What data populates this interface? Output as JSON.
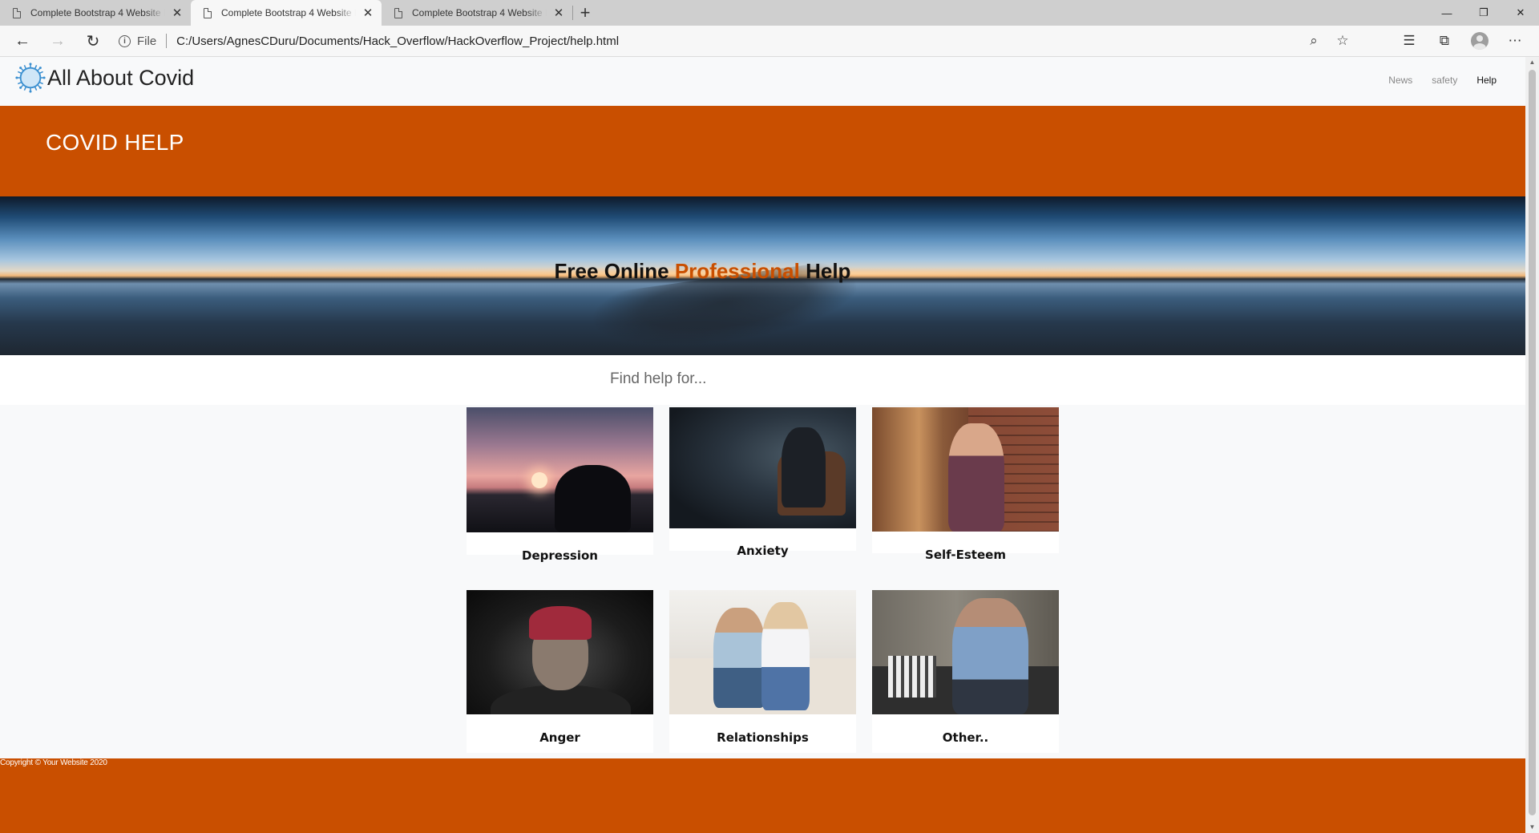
{
  "browser": {
    "tabs": [
      {
        "title": "Complete Bootstrap 4 Website Layout",
        "active": false
      },
      {
        "title": "Complete Bootstrap 4 Website Layout",
        "active": true
      },
      {
        "title": "Complete Bootstrap 4 Website Layout",
        "active": false
      }
    ],
    "address": {
      "scheme_label": "File",
      "url": "C:/Users/AgnesCDuru/Documents/Hack_Overflow/HackOverflow_Project/help.html"
    }
  },
  "site": {
    "brand": "All About Covid",
    "nav": [
      {
        "label": "News",
        "active": false
      },
      {
        "label": "safety",
        "active": false
      },
      {
        "label": "Help",
        "active": true
      }
    ],
    "header_title": "COVID HELP",
    "hero": {
      "before": "Free Online ",
      "accent": "Professional",
      "after": " Help"
    },
    "find_help": "Find help for...",
    "cards": [
      {
        "label": "Depression"
      },
      {
        "label": "Anxiety"
      },
      {
        "label": "Self-Esteem"
      },
      {
        "label": "Anger"
      },
      {
        "label": "Relationships"
      },
      {
        "label": "Other.."
      }
    ],
    "footer": "Copyright © Your Website 2020"
  },
  "colors": {
    "accent": "#c94f00",
    "page_bg": "#f8f9fa"
  }
}
